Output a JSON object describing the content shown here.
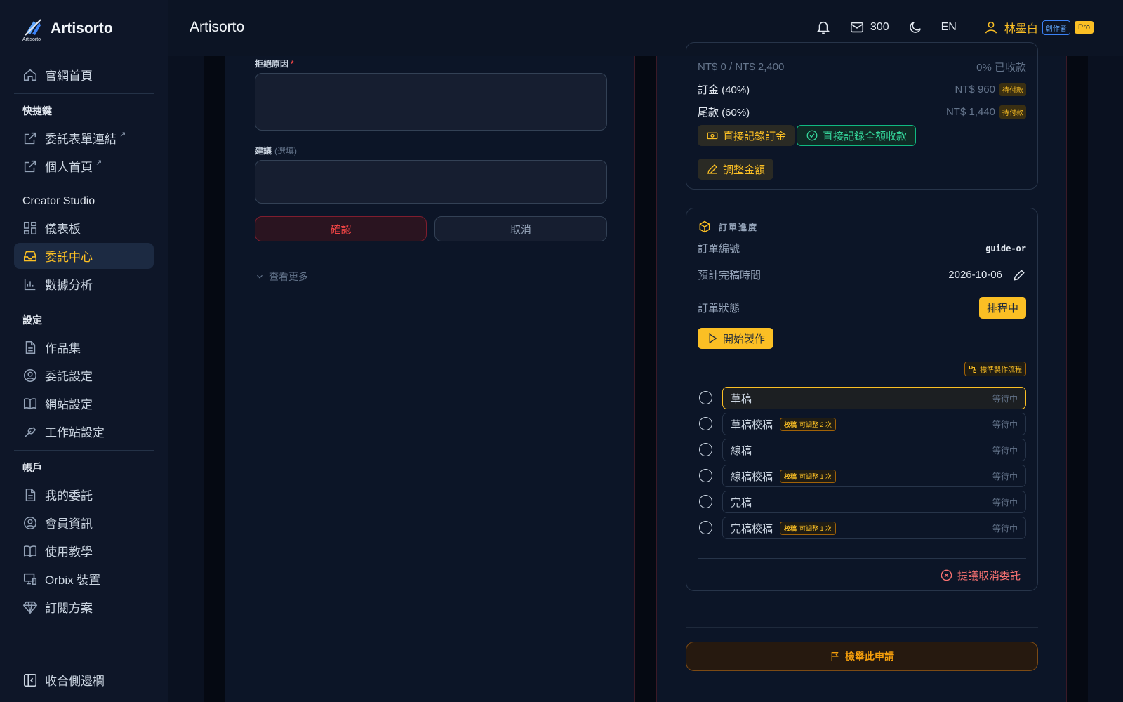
{
  "brand": {
    "name": "Artisorto",
    "logo_tag": "Artisorto"
  },
  "header": {
    "title": "Artisorto",
    "mail_count": "300",
    "lang": "EN",
    "user_name": "林墨白",
    "creator_badge": "創作者",
    "pro_badge": "Pro"
  },
  "sidebar": {
    "home": "官網首頁",
    "shortcuts_heading": "快捷鍵",
    "form_link": "委託表單連結",
    "profile_link": "個人首頁",
    "studio_heading": "Creator Studio",
    "dashboard": "儀表板",
    "commissions": "委託中心",
    "analytics": "數據分析",
    "settings_heading": "設定",
    "portfolio": "作品集",
    "commission_settings": "委託設定",
    "site_settings": "網站設定",
    "workstation_settings": "工作站設定",
    "account_heading": "帳戶",
    "my_commissions": "我的委託",
    "member_info": "會員資訊",
    "tutorial": "使用教學",
    "orbix": "Orbix 裝置",
    "subscription": "訂閱方案",
    "collapse": "收合側邊欄",
    "ext_mark": "↗"
  },
  "reject_form": {
    "reason_label": "拒絕原因",
    "required_mark": "*",
    "suggest_label": "建議",
    "optional_mark": "(選填)",
    "confirm": "確認",
    "cancel": "取消",
    "more": "查看更多"
  },
  "payment": {
    "summary_left": "NT$ 0 / NT$ 2,400",
    "summary_right": "0% 已收款",
    "deposit_label": "訂金 (40%)",
    "deposit_amount": "NT$ 960",
    "balance_label": "尾款 (60%)",
    "balance_amount": "NT$ 1,440",
    "pending_tag": "待付款",
    "record_deposit": "直接記錄訂金",
    "record_full": "直接記錄全額收款",
    "adjust_amount": "調整金額"
  },
  "progress": {
    "heading": "訂單進度",
    "order_no_label": "訂單編號",
    "order_no": "guide-or",
    "eta_label": "預計完稿時間",
    "eta": "2026-10-06",
    "status_label": "訂單狀態",
    "status": "排程中",
    "start": "開始製作",
    "flow_tag": "標準製作流程",
    "review_key": "校稿",
    "steps": [
      {
        "name": "草稿",
        "status": "等待中",
        "review": ""
      },
      {
        "name": "草稿校稿",
        "status": "等待中",
        "review": "可調整 2 次"
      },
      {
        "name": "線稿",
        "status": "等待中",
        "review": ""
      },
      {
        "name": "線稿校稿",
        "status": "等待中",
        "review": "可調整 1 次"
      },
      {
        "name": "完稿",
        "status": "等待中",
        "review": ""
      },
      {
        "name": "完稿校稿",
        "status": "等待中",
        "review": "可調整 1 次"
      }
    ],
    "propose_cancel": "提議取消委託"
  },
  "report": "檢舉此申請",
  "colors": {
    "accent": "#fbbf24",
    "danger": "#ef4444",
    "success": "#34d399",
    "bg": "#0c1424"
  }
}
